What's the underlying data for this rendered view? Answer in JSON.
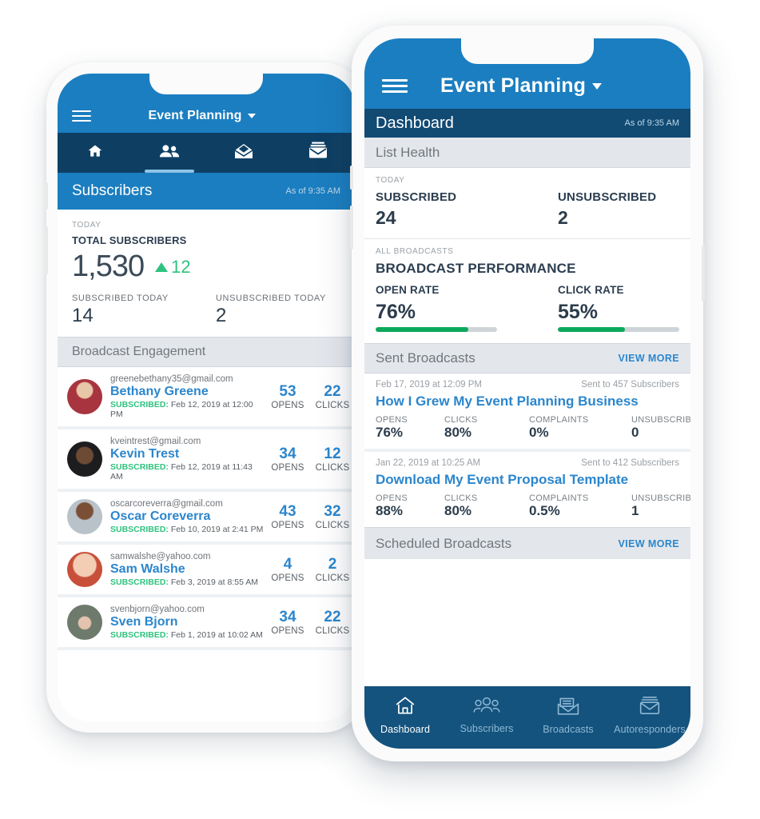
{
  "back_phone": {
    "appbar": {
      "menu_icon": "hamburger-icon",
      "title": "Event Planning",
      "caret_icon": "chevron-down-icon"
    },
    "tabs": [
      {
        "name": "home",
        "icon": "home-icon",
        "active": false
      },
      {
        "name": "subscribers",
        "icon": "people-icon",
        "active": true
      },
      {
        "name": "broadcasts",
        "icon": "open-envelope-icon",
        "active": false
      },
      {
        "name": "autoresponders",
        "icon": "stacked-envelope-icon",
        "active": false
      }
    ],
    "subbar": {
      "title": "Subscribers",
      "time": "As of 9:35 AM"
    },
    "summary": {
      "eyebrow": "TODAY",
      "label": "TOTAL SUBSCRIBERS",
      "total": "1,530",
      "delta": "12",
      "delta_icon": "triangle-up-icon",
      "subscribed_label": "SUBSCRIBED TODAY",
      "subscribed_value": "14",
      "unsubscribed_label": "UNSUBSCRIBED TODAY",
      "unsubscribed_value": "2"
    },
    "section": {
      "title": "Broadcast Engagement"
    },
    "subscribers": [
      {
        "email": "greenebethany35@gmail.com",
        "name": "Bethany Greene",
        "status": "SUBSCRIBED:",
        "date": " Feb 12, 2019 at 12:00 PM",
        "opens": "53",
        "opens_label": "OPENS",
        "clicks": "22",
        "clicks_label": "CLICKS",
        "avatar": "avatar-woman-red-sweater"
      },
      {
        "email": "kveintrest@gmail.com",
        "name": "Kevin Trest",
        "status": "SUBSCRIBED:",
        "date": " Feb 12, 2019 at 11:43 AM",
        "opens": "34",
        "opens_label": "OPENS",
        "clicks": "12",
        "clicks_label": "CLICKS",
        "avatar": "avatar-man-dark-background"
      },
      {
        "email": "oscarcoreverra@gmail.com",
        "name": "Oscar Coreverra",
        "status": "SUBSCRIBED:",
        "date": " Feb 10, 2019 at 2:41 PM",
        "opens": "43",
        "opens_label": "OPENS",
        "clicks": "32",
        "clicks_label": "CLICKS",
        "avatar": "avatar-man-grey-shirt"
      },
      {
        "email": "samwalshe@yahoo.com",
        "name": "Sam Walshe",
        "status": "SUBSCRIBED:",
        "date": " Feb 3, 2019 at 8:55 AM",
        "opens": "4",
        "opens_label": "OPENS",
        "clicks": "2",
        "clicks_label": "CLICKS",
        "avatar": "avatar-child-smiling"
      },
      {
        "email": "svenbjorn@yahoo.com",
        "name": "Sven Bjorn",
        "status": "SUBSCRIBED:",
        "date": " Feb 1, 2019 at 10:02 AM",
        "opens": "34",
        "opens_label": "OPENS",
        "clicks": "22",
        "clicks_label": "CLICKS",
        "avatar": "avatar-person-grey-beanie"
      }
    ]
  },
  "front_phone": {
    "appbar": {
      "menu_icon": "hamburger-icon",
      "title": "Event Planning",
      "caret_icon": "chevron-down-icon"
    },
    "subbar": {
      "title": "Dashboard",
      "time": "As of 9:35 AM"
    },
    "list_health": {
      "section_title": "List Health",
      "eyebrow": "TODAY",
      "subscribed_label": "SUBSCRIBED",
      "subscribed_value": "24",
      "unsubscribed_label": "UNSUBSCRIBED",
      "unsubscribed_value": "2"
    },
    "broadcast_performance": {
      "eyebrow": "ALL BROADCASTS",
      "title": "BROADCAST PERFORMANCE",
      "open_rate_label": "OPEN RATE",
      "open_rate_value": "76%",
      "open_rate_pct": 76,
      "click_rate_label": "CLICK RATE",
      "click_rate_value": "55%",
      "click_rate_pct": 55
    },
    "sent_broadcasts": {
      "section_title": "Sent Broadcasts",
      "view_more": "VIEW MORE",
      "items": [
        {
          "date": "Feb 17, 2019 at 12:09 PM",
          "sent_to": "Sent to 457 Subscribers",
          "title": "How I Grew My Event Planning Business",
          "stats": [
            {
              "label": "OPENS",
              "value": "76%"
            },
            {
              "label": "CLICKS",
              "value": "80%"
            },
            {
              "label": "COMPLAINTS",
              "value": "0%"
            },
            {
              "label": "UNSUBSCRIBES",
              "value": "0"
            }
          ]
        },
        {
          "date": "Jan 22, 2019 at 10:25 AM",
          "sent_to": "Sent to 412 Subscribers",
          "title": "Download My Event Proposal Template",
          "stats": [
            {
              "label": "OPENS",
              "value": "88%"
            },
            {
              "label": "CLICKS",
              "value": "80%"
            },
            {
              "label": "COMPLAINTS",
              "value": "0.5%"
            },
            {
              "label": "UNSUBSCRIBES",
              "value": "1"
            }
          ]
        }
      ]
    },
    "scheduled_broadcasts": {
      "section_title": "Scheduled Broadcasts",
      "view_more": "VIEW MORE"
    },
    "bottom_nav": [
      {
        "label": "Dashboard",
        "icon": "home-outline-icon",
        "active": true
      },
      {
        "label": "Subscribers",
        "icon": "people-outline-icon",
        "active": false
      },
      {
        "label": "Broadcasts",
        "icon": "open-envelope-outline-icon",
        "active": false
      },
      {
        "label": "Autoresponders",
        "icon": "envelope-outline-icon",
        "active": false
      }
    ]
  },
  "colors": {
    "brand_blue": "#1b7ec0",
    "dark_blue": "#114a73",
    "nav_blue": "#14537e",
    "tabbar_blue": "#0e3f63",
    "link_blue": "#2b86cd",
    "green": "#0ba95c",
    "status_green": "#2ec27e",
    "section_grey": "#e3e7ec"
  }
}
